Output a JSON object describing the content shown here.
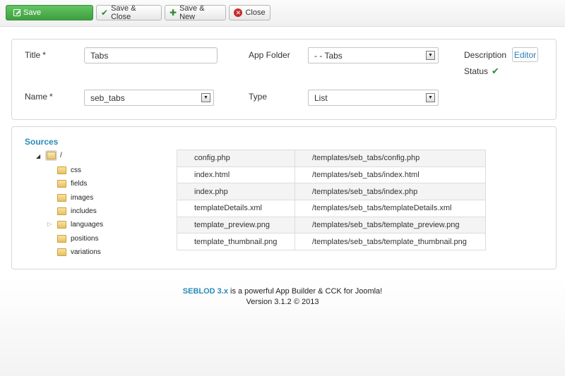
{
  "toolbar": {
    "save_label": "Save",
    "save_close_label": "Save & Close",
    "save_new_label": "Save & New",
    "close_label": "Close"
  },
  "form": {
    "title_label": "Title",
    "title_value": "Tabs",
    "name_label": "Name",
    "name_value": "seb_tabs",
    "required_mark": "*",
    "app_folder_label": "App Folder",
    "app_folder_value": "- - Tabs",
    "type_label": "Type",
    "type_value": "List",
    "description_label": "Description",
    "editor_button": "Editor",
    "status_label": "Status",
    "status_icon": "check-icon"
  },
  "sources": {
    "title": "Sources",
    "root": "/",
    "folders": [
      "css",
      "fields",
      "images",
      "includes",
      "languages",
      "positions",
      "variations"
    ],
    "files": [
      {
        "name": "config.php",
        "path": "/templates/seb_tabs/config.php"
      },
      {
        "name": "index.html",
        "path": "/templates/seb_tabs/index.html"
      },
      {
        "name": "index.php",
        "path": "/templates/seb_tabs/index.php"
      },
      {
        "name": "templateDetails.xml",
        "path": "/templates/seb_tabs/templateDetails.xml"
      },
      {
        "name": "template_preview.png",
        "path": "/templates/seb_tabs/template_preview.png"
      },
      {
        "name": "template_thumbnail.png",
        "path": "/templates/seb_tabs/template_thumbnail.png"
      }
    ]
  },
  "footer": {
    "brand": "SEBLOD 3.x",
    "tagline": " is a powerful App Builder & CCK for Joomla!",
    "version": "Version 3.1.2 © 2013"
  },
  "colors": {
    "accent": "#2a8ab8",
    "save_green": "#4cae4c",
    "close_red": "#c62d2d"
  }
}
